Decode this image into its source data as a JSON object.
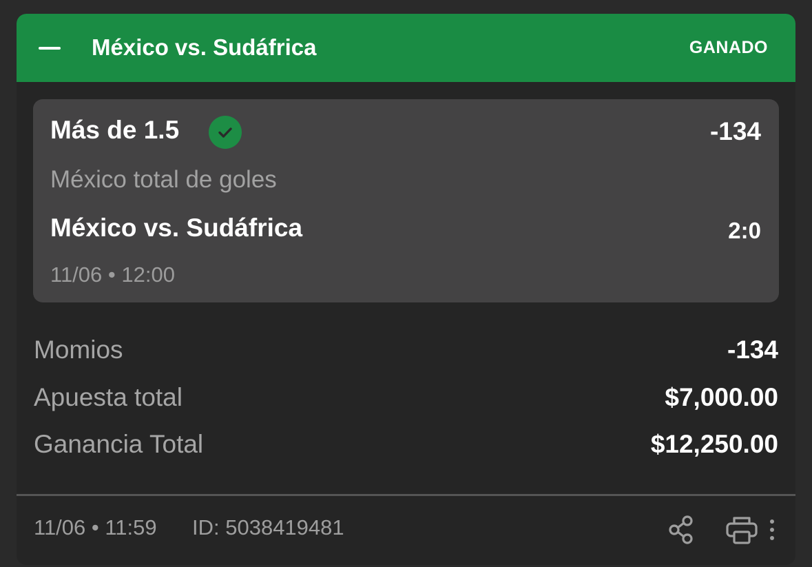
{
  "header": {
    "title": "México vs. Sudáfrica",
    "status": "GANADO",
    "accent_color": "#1a8c44",
    "collapse_icon": "minus-icon"
  },
  "selection": {
    "name": "Más de 1.5",
    "result_icon": "check-circle-icon",
    "odds": "-134",
    "market": "México total de goles",
    "event": "México vs. Sudáfrica",
    "score": "2:0",
    "datetime": "11/06 • 12:00"
  },
  "summary": {
    "odds_label": "Momios",
    "odds_value": "-134",
    "stake_label": "Apuesta total",
    "stake_value": "$7,000.00",
    "payout_label": "Ganancia Total",
    "payout_value": "$12,250.00"
  },
  "footer": {
    "datetime": "11/06 • 11:59",
    "bet_id": "ID: 5038419481",
    "share_icon": "share-icon",
    "print_icon": "print-icon",
    "more_icon": "more-vertical-icon"
  }
}
